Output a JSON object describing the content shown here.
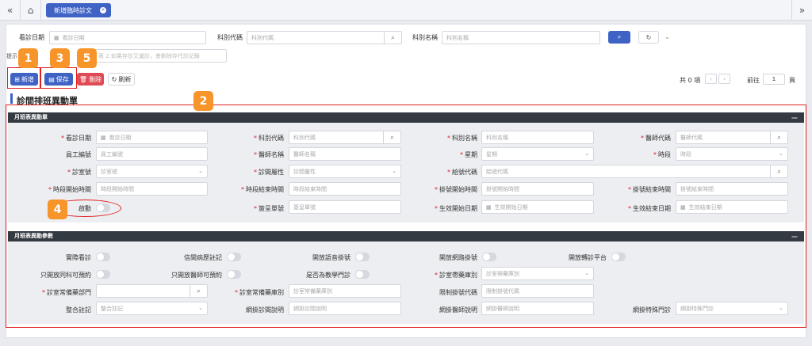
{
  "nav": {
    "tab_label": "新增臨時診文",
    "tab_close": "×"
  },
  "search": {
    "date_label": "看診日期",
    "date_placeholder": "看診日期",
    "dept_code_label": "科別代碼",
    "dept_code_placeholder": "科別代碼",
    "dept_name_label": "科別名稱",
    "dept_name_placeholder": "科別名稱"
  },
  "hint": {
    "prefix": "提示",
    "text": "表 2.如果存診又邊診，會刪除存代診記錄"
  },
  "toolbar": {
    "add": "新增",
    "save": "保存",
    "delete": "刪除",
    "refresh": "刷新"
  },
  "pager": {
    "total": "共 0 項",
    "goto": "前往",
    "page_value": "1",
    "page_suffix": "頁"
  },
  "page_title": "診間排班異動單",
  "section1": {
    "title": "月班表異動單",
    "fields": {
      "visit_date": {
        "label": "看診日期",
        "placeholder": "看診日期"
      },
      "dept_code": {
        "label": "科別代碼",
        "placeholder": "科別代碼"
      },
      "dept_name": {
        "label": "科別名稱",
        "placeholder": "科別名稱"
      },
      "doctor_code": {
        "label": "醫師代碼",
        "placeholder": "醫師代碼"
      },
      "emp_no": {
        "label": "員工編號",
        "placeholder": "員工編號"
      },
      "doctor_name": {
        "label": "醫師名稱",
        "placeholder": "醫師名稱"
      },
      "weekday": {
        "label": "星期",
        "placeholder": "星期"
      },
      "period": {
        "label": "時段",
        "placeholder": "時段"
      },
      "room_no": {
        "label": "診室號",
        "placeholder": "診室號"
      },
      "room_attr": {
        "label": "診間屬性",
        "placeholder": "診間屬性"
      },
      "slot_code": {
        "label": "給號代碼",
        "placeholder": "給號代碼"
      },
      "period_start": {
        "label": "時段開始時間",
        "placeholder": "時段開始時間"
      },
      "period_end": {
        "label": "時段結束時間",
        "placeholder": "時段結束時間"
      },
      "reg_start": {
        "label": "掛號開始時間",
        "placeholder": "掛號開始時間"
      },
      "reg_end": {
        "label": "掛號結束時間",
        "placeholder": "掛號結束時間"
      },
      "enable": {
        "label": "啟動"
      },
      "sign_no": {
        "label": "簽呈單號",
        "placeholder": "簽呈單號"
      },
      "eff_start": {
        "label": "生效開始日期",
        "placeholder": "生效開始日期"
      },
      "eff_end": {
        "label": "生效結束日期",
        "placeholder": "生效結束日期"
      }
    }
  },
  "section2": {
    "title": "月班表異動參數",
    "toggles": [
      "實際看診",
      "信間病歷註記",
      "開放語音掛號",
      "開放網路掛號",
      "開放轉診平台",
      "只開放同科可預約",
      "只開放醫師可預約",
      "是否為教學門診"
    ],
    "fields": {
      "med_area": {
        "label": "診室帶藥庫別",
        "placeholder": "診室帶藥庫別"
      },
      "common_dept": {
        "label": "診室常備藥部門"
      },
      "common_store": {
        "label": "診室常備藥庫別",
        "placeholder": "診室常備藥庫別"
      },
      "limit_code": {
        "label": "限制掛號代碼",
        "placeholder": "限制掛號代碼"
      },
      "combine_note": {
        "label": "整合註記",
        "placeholder": "整合註記"
      },
      "web_room": {
        "label": "網掛診間說明",
        "placeholder": "網掛診間說明"
      },
      "web_doc": {
        "label": "網掛醫師說明",
        "placeholder": "網掛醫師說明"
      },
      "web_special": {
        "label": "網掛特殊門診",
        "placeholder": "網掛特殊門診"
      }
    }
  },
  "badges": [
    "1",
    "2",
    "3",
    "4",
    "5"
  ],
  "colors": {
    "primary": "#3f63c4",
    "danger": "#e04a55",
    "badge": "#f7942a",
    "highlight": "#e02020",
    "section": "#333a42"
  }
}
